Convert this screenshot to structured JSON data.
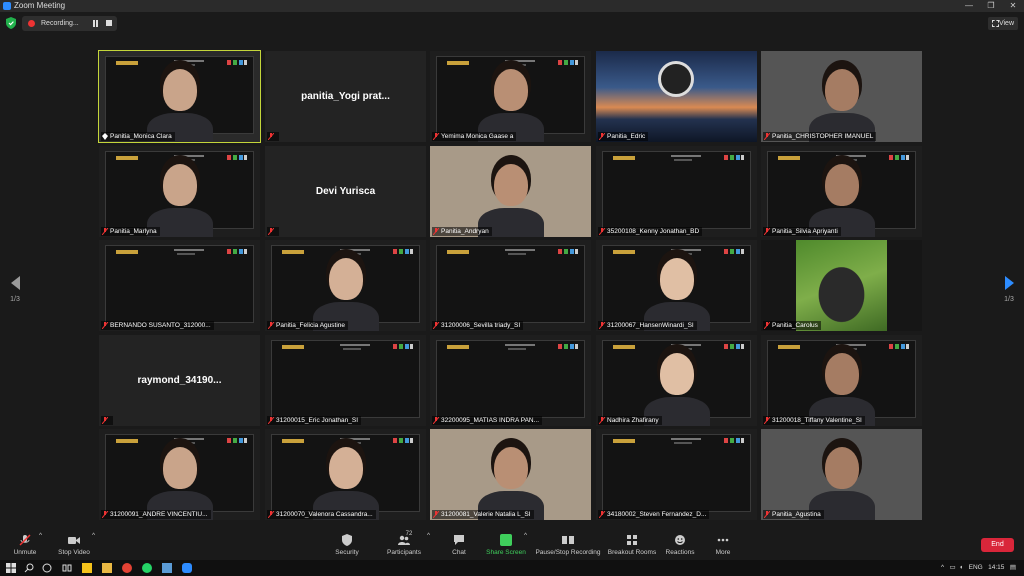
{
  "window": {
    "title": "Zoom Meeting"
  },
  "topbar": {
    "recording_label": "Recording...",
    "view_label": "View"
  },
  "pager": {
    "left": "1/3",
    "right": "1/3"
  },
  "tiles": [
    {
      "name": "Panitia_Monica Clara",
      "type": "cam"
    },
    {
      "name": "panitia_Yogi prat...",
      "type": "name"
    },
    {
      "name": "Yemima Monica Gaase a",
      "type": "slide"
    },
    {
      "name": "Panitia_Edric",
      "type": "art"
    },
    {
      "name": "Panitia_CHRISTOPHER IMANUEL",
      "type": "cam"
    },
    {
      "name": "Panitia_Marlyna",
      "type": "slide"
    },
    {
      "name": "Devi Yurisca",
      "type": "name"
    },
    {
      "name": "Panitia_Andryan",
      "type": "cam"
    },
    {
      "name": "35200108_Kenny Jonathan_BD",
      "type": "slide"
    },
    {
      "name": "Panitia_Silvia Apriyanti",
      "type": "slide"
    },
    {
      "name": "BERNANDO SUSANTO_312000...",
      "type": "slide"
    },
    {
      "name": "Panitia_Felicia Agustine",
      "type": "slide"
    },
    {
      "name": "31200006_Sevilla triady_SI",
      "type": "slide"
    },
    {
      "name": "31200067_HansenWinardi_SI",
      "type": "slide"
    },
    {
      "name": "Panitia_Carolus",
      "type": "animal"
    },
    {
      "name": "raymond_34190...",
      "type": "name"
    },
    {
      "name": "31200015_Eric Jonathan_SI",
      "type": "slide"
    },
    {
      "name": "32200095_MATIAS INDRA PAN...",
      "type": "slide"
    },
    {
      "name": "Nadhira Zhafirany",
      "type": "slide"
    },
    {
      "name": "31200018_Tiffany Valentine_SI",
      "type": "slide"
    },
    {
      "name": "31200091_ANDRE VINCENTIU...",
      "type": "slide"
    },
    {
      "name": "31200070_Valenora Cassandra...",
      "type": "slide"
    },
    {
      "name": "31200081_Valerie Natalia L_SI",
      "type": "cam"
    },
    {
      "name": "34180002_Steven Fernandez_D...",
      "type": "slide"
    },
    {
      "name": "Panitia_Agustina",
      "type": "cam"
    }
  ],
  "toolbar": {
    "unmute": "Unmute",
    "stop_video": "Stop Video",
    "security": "Security",
    "participants": "Participants",
    "participant_count": "72",
    "chat": "Chat",
    "share_screen": "Share Screen",
    "pause_recording": "Pause/Stop Recording",
    "breakout_rooms": "Breakout Rooms",
    "reactions": "Reactions",
    "more": "More",
    "end": "End"
  },
  "taskbar": {
    "lang": "ENG",
    "time": "14:15"
  },
  "colors": {
    "accent": "#2d8cff",
    "active_speaker": "#c4d63a",
    "share": "#3fcf5c",
    "end": "#d9263a"
  }
}
